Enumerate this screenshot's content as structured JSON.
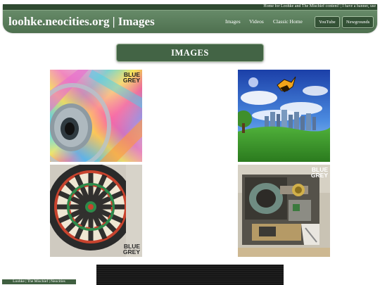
{
  "header": {
    "marquee_text": "Home for Loohke and The Mischief content! | I have a banner, use",
    "site_title": "loohke.neocities.org | Images",
    "nav": {
      "images": "Images",
      "videos": "Videos",
      "classic_home": "Classic Home",
      "youtube": "YouTube",
      "newgrounds": "Newgrounds"
    }
  },
  "main": {
    "heading": "IMAGES",
    "tiles": [
      {
        "icon": "cd-disc-image",
        "stamp": [
          "BLUE",
          "GREY"
        ]
      },
      {
        "icon": "city-landscape-image",
        "stamp": []
      },
      {
        "icon": "dartboard-image",
        "stamp": [
          "BLUE",
          "GREY"
        ]
      },
      {
        "icon": "crt-monitor-image",
        "stamp": [
          "BLUE",
          "GREY"
        ]
      }
    ]
  },
  "footer": {
    "badge_text": "Loohke | The Mischief | Neocities"
  },
  "colors": {
    "header_green": "#557757",
    "header_dark": "#2f4a31",
    "button_green": "#345236",
    "heading_green": "#436445"
  }
}
